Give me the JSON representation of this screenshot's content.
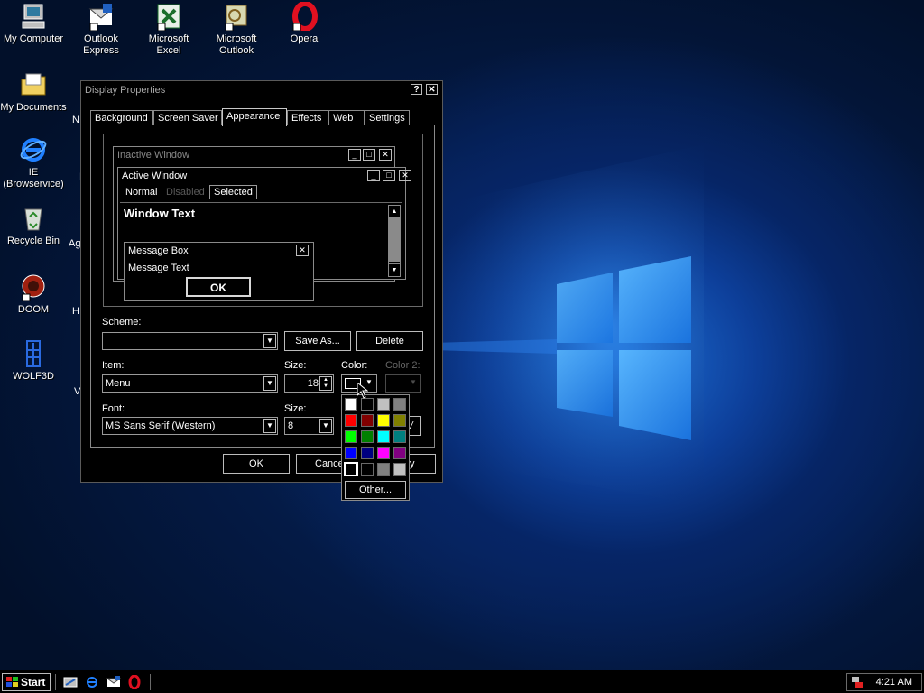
{
  "desktop": {
    "icons": [
      {
        "label": "My Computer",
        "icon": "computer-icon"
      },
      {
        "label": "Outlook Express",
        "icon": "outlook-express-icon"
      },
      {
        "label": "Microsoft Excel",
        "icon": "excel-icon"
      },
      {
        "label": "Microsoft Outlook",
        "icon": "outlook-icon"
      },
      {
        "label": "Opera",
        "icon": "opera-icon"
      },
      {
        "label": "My Documents",
        "icon": "folder-icon"
      },
      {
        "label": "IE (Browservice)",
        "icon": "internet-explorer-icon"
      },
      {
        "label": "Recycle Bin",
        "icon": "recycle-bin-icon"
      },
      {
        "label": "DOOM",
        "icon": "doom-icon"
      },
      {
        "label": "WOLF3D",
        "icon": "wolf3d-icon"
      }
    ],
    "partial_labels": [
      "N",
      "I",
      "Ag",
      "H",
      "V"
    ]
  },
  "dialog": {
    "title": "Display Properties",
    "help_btn": "?",
    "close_btn": "✕",
    "tabs": [
      "Background",
      "Screen Saver",
      "Appearance",
      "Effects",
      "Web",
      "Settings"
    ],
    "active_tab": "Appearance",
    "preview": {
      "inactive_title": "Inactive Window",
      "active_title": "Active Window",
      "menu_normal": "Normal",
      "menu_disabled": "Disabled",
      "menu_selected": "Selected",
      "window_text": "Window Text",
      "msgbox_title": "Message Box",
      "msgbox_text": "Message Text",
      "msgbox_ok": "OK"
    },
    "scheme_label": "Scheme:",
    "scheme_value": "",
    "save_as": "Save As...",
    "delete": "Delete",
    "item_label": "Item:",
    "item_value": "Menu",
    "size_label": "Size:",
    "size_value": "18",
    "color_label": "Color:",
    "color2_label": "Color 2:",
    "font_label": "Font:",
    "font_value": "MS Sans Serif (Western)",
    "font_size_label": "Size:",
    "font_size_value": "8",
    "ok": "OK",
    "cancel": "Cancel",
    "apply_partial": "y"
  },
  "palette": {
    "colors": [
      "#ffffff",
      "#000000",
      "#c0c0c0",
      "#808080",
      "#ff0000",
      "#800000",
      "#ffff00",
      "#808000",
      "#00ff00",
      "#008000",
      "#00ffff",
      "#008080",
      "#0000ff",
      "#000080",
      "#ff00ff",
      "#800080",
      "#000000",
      "#000000",
      "#808080",
      "#c0c0c0"
    ],
    "other": "Other..."
  },
  "taskbar": {
    "start": "Start",
    "clock": "4:21 AM",
    "quick_launch": [
      "show-desktop-icon",
      "internet-explorer-icon",
      "outlook-express-icon",
      "opera-icon"
    ]
  }
}
